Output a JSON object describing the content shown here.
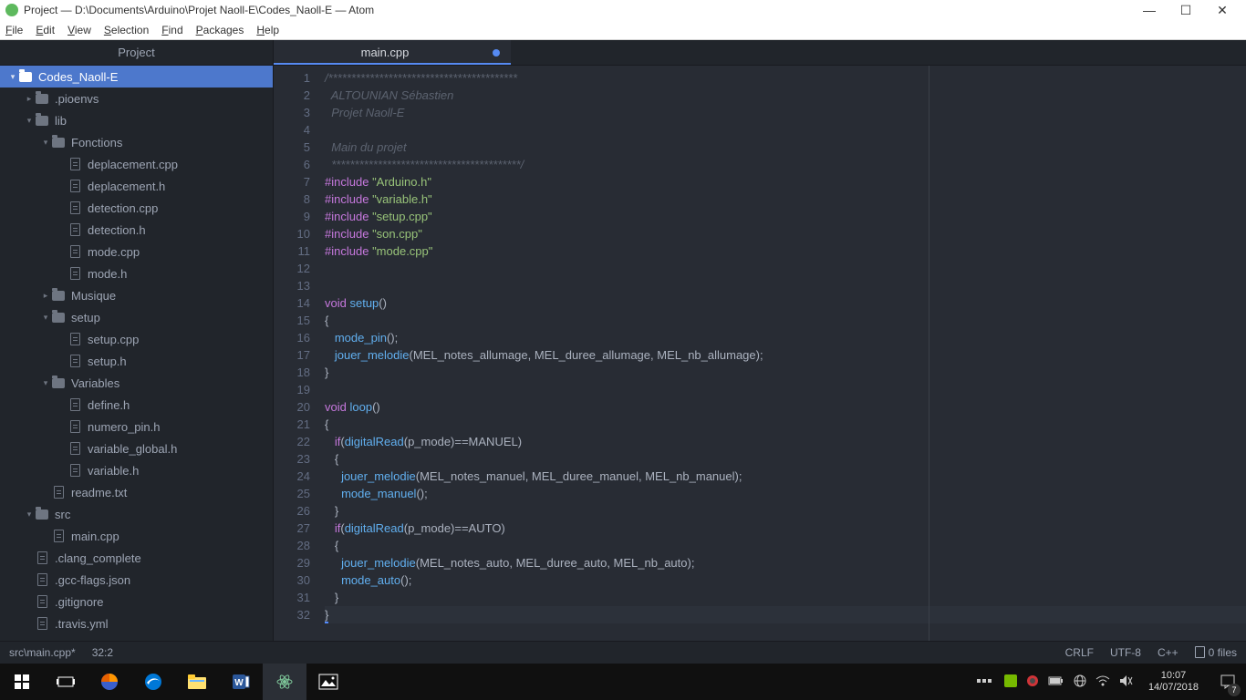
{
  "window": {
    "title": "Project — D:\\Documents\\Arduino\\Projet Naoll-E\\Codes_Naoll-E — Atom"
  },
  "menu": [
    "File",
    "Edit",
    "View",
    "Selection",
    "Find",
    "Packages",
    "Help"
  ],
  "tree_header": "Project",
  "tree": [
    {
      "d": 0,
      "t": "folder",
      "exp": "down",
      "label": "Codes_Naoll-E",
      "sel": true
    },
    {
      "d": 1,
      "t": "folder",
      "exp": "right",
      "label": ".pioenvs"
    },
    {
      "d": 1,
      "t": "folder",
      "exp": "down",
      "label": "lib"
    },
    {
      "d": 2,
      "t": "folder",
      "exp": "down",
      "label": "Fonctions"
    },
    {
      "d": 3,
      "t": "file",
      "label": "deplacement.cpp"
    },
    {
      "d": 3,
      "t": "file",
      "label": "deplacement.h"
    },
    {
      "d": 3,
      "t": "file",
      "label": "detection.cpp"
    },
    {
      "d": 3,
      "t": "file",
      "label": "detection.h"
    },
    {
      "d": 3,
      "t": "file",
      "label": "mode.cpp"
    },
    {
      "d": 3,
      "t": "file",
      "label": "mode.h"
    },
    {
      "d": 2,
      "t": "folder",
      "exp": "right",
      "label": "Musique"
    },
    {
      "d": 2,
      "t": "folder",
      "exp": "down",
      "label": "setup"
    },
    {
      "d": 3,
      "t": "file",
      "label": "setup.cpp"
    },
    {
      "d": 3,
      "t": "file",
      "label": "setup.h"
    },
    {
      "d": 2,
      "t": "folder",
      "exp": "down",
      "label": "Variables"
    },
    {
      "d": 3,
      "t": "file",
      "label": "define.h"
    },
    {
      "d": 3,
      "t": "file",
      "label": "numero_pin.h"
    },
    {
      "d": 3,
      "t": "file",
      "label": "variable_global.h"
    },
    {
      "d": 3,
      "t": "file",
      "label": "variable.h"
    },
    {
      "d": 2,
      "t": "file",
      "label": "readme.txt"
    },
    {
      "d": 1,
      "t": "folder",
      "exp": "down",
      "label": "src"
    },
    {
      "d": 2,
      "t": "file",
      "label": "main.cpp"
    },
    {
      "d": 1,
      "t": "file",
      "label": ".clang_complete"
    },
    {
      "d": 1,
      "t": "file",
      "label": ".gcc-flags.json"
    },
    {
      "d": 1,
      "t": "file",
      "label": ".gitignore"
    },
    {
      "d": 1,
      "t": "file",
      "label": ".travis.yml"
    }
  ],
  "tab": {
    "title": "main.cpp",
    "modified": true
  },
  "code": [
    {
      "n": 1,
      "h": "<span class='cmt'>/*****************************************</span>"
    },
    {
      "n": 2,
      "h": "<span class='cmt'>  ALTOUNIAN Sébastien</span>"
    },
    {
      "n": 3,
      "h": "<span class='cmt'>  Projet Naoll-E</span>"
    },
    {
      "n": 4,
      "h": "<span class='cmt'></span>"
    },
    {
      "n": 5,
      "h": "<span class='cmt'>  Main du projet</span>"
    },
    {
      "n": 6,
      "h": "<span class='cmt'>  *****************************************/</span>"
    },
    {
      "n": 7,
      "h": "<span class='kw'>#include</span> <span class='str'>\"Arduino.h\"</span>"
    },
    {
      "n": 8,
      "h": "<span class='kw'>#include</span> <span class='str'>\"variable.h\"</span>"
    },
    {
      "n": 9,
      "h": "<span class='kw'>#include</span> <span class='str'>\"setup.cpp\"</span>"
    },
    {
      "n": 10,
      "h": "<span class='kw'>#include</span> <span class='str'>\"son.cpp\"</span>"
    },
    {
      "n": 11,
      "h": "<span class='kw'>#include</span> <span class='str'>\"mode.cpp\"</span>"
    },
    {
      "n": 12,
      "h": ""
    },
    {
      "n": 13,
      "h": ""
    },
    {
      "n": 14,
      "h": "<span class='ty'>void</span> <span class='fn'>setup</span>()"
    },
    {
      "n": 15,
      "h": "{"
    },
    {
      "n": 16,
      "h": "   <span class='fn'>mode_pin</span>();"
    },
    {
      "n": 17,
      "h": "   <span class='fn'>jouer_melodie</span>(MEL_notes_allumage, MEL_duree_allumage, MEL_nb_allumage);"
    },
    {
      "n": 18,
      "h": "}"
    },
    {
      "n": 19,
      "h": ""
    },
    {
      "n": 20,
      "h": "<span class='ty'>void</span> <span class='fn'>loop</span>()"
    },
    {
      "n": 21,
      "h": "{"
    },
    {
      "n": 22,
      "h": "   <span class='kw'>if</span>(<span class='fn'>digitalRead</span>(p_mode)==MANUEL)"
    },
    {
      "n": 23,
      "h": "   {"
    },
    {
      "n": 24,
      "h": "     <span class='fn'>jouer_melodie</span>(MEL_notes_manuel, MEL_duree_manuel, MEL_nb_manuel);"
    },
    {
      "n": 25,
      "h": "     <span class='fn'>mode_manuel</span>();"
    },
    {
      "n": 26,
      "h": "   }"
    },
    {
      "n": 27,
      "h": "   <span class='kw'>if</span>(<span class='fn'>digitalRead</span>(p_mode)==AUTO)"
    },
    {
      "n": 28,
      "h": "   {"
    },
    {
      "n": 29,
      "h": "     <span class='fn'>jouer_melodie</span>(MEL_notes_auto, MEL_duree_auto, MEL_nb_auto);"
    },
    {
      "n": 30,
      "h": "     <span class='fn'>mode_auto</span>();"
    },
    {
      "n": 31,
      "h": "   }"
    },
    {
      "n": 32,
      "h": "<span class='cur'>}</span>",
      "cl": true
    }
  ],
  "status": {
    "path": "src\\main.cpp*",
    "pos": "32:2",
    "eol": "CRLF",
    "enc": "UTF-8",
    "lang": "C++",
    "files": "0 files"
  },
  "clock": {
    "time": "10:07",
    "date": "14/07/2018"
  },
  "notif_count": "7"
}
